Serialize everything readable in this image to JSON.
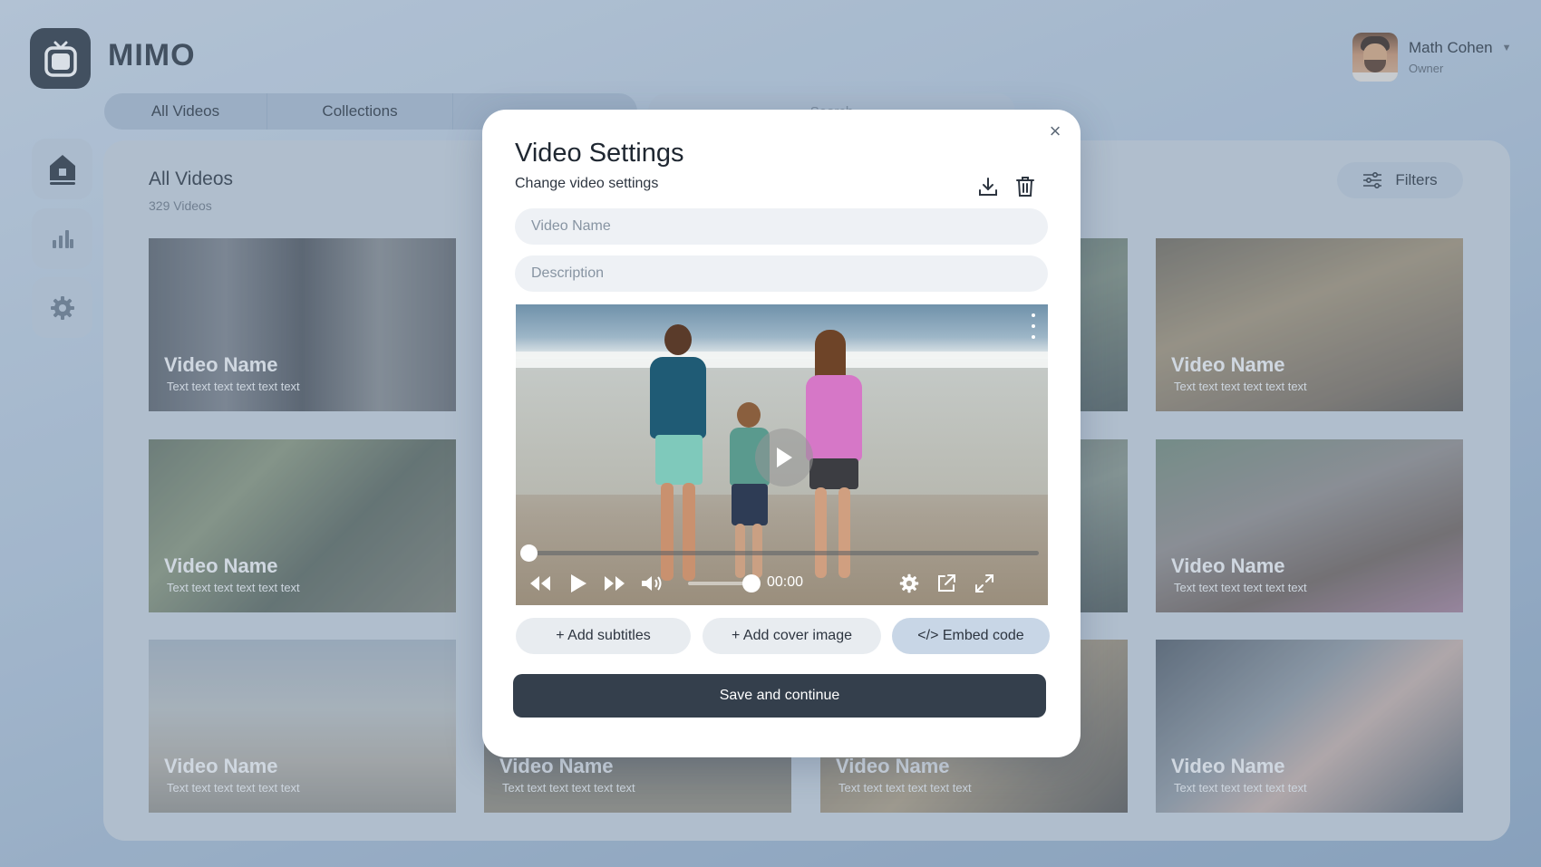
{
  "app": {
    "brand": "MIMO"
  },
  "user": {
    "name": "Math Cohen",
    "role": "Owner"
  },
  "tabs": [
    {
      "label": "All Videos"
    },
    {
      "label": "Collections"
    },
    {
      "label": ""
    }
  ],
  "search": {
    "placeholder": "Search"
  },
  "main": {
    "title": "All Videos",
    "count": "329 Videos",
    "filters_label": "Filters"
  },
  "videos": [
    {
      "name": "Video Name",
      "text": "Text text text text text text"
    },
    {
      "name": "Video Name",
      "text": "Text text text text text text"
    },
    {
      "name": "Video Name",
      "text": "Text text text text text text"
    },
    {
      "name": "Video Name",
      "text": "Text text text text text text"
    },
    {
      "name": "Video Name",
      "text": "Text text text text text text"
    },
    {
      "name": "Video Name",
      "text": "Text text text text text text"
    },
    {
      "name": "Video Name",
      "text": "Text text text text text text"
    },
    {
      "name": "Video Name",
      "text": "Text text text text text text"
    }
  ],
  "modal": {
    "title": "Video Settings",
    "subtitle": "Change video settings",
    "close": "×",
    "fields": {
      "name_placeholder": "Video Name",
      "description_placeholder": "Description"
    },
    "player": {
      "time": "00:00",
      "progress_fraction": 0.0,
      "volume_fraction": 1.0
    },
    "buttons": {
      "subtitles": "+ Add subtitles",
      "cover": "+ Add cover image",
      "embed": "</> Embed code",
      "save": "Save and continue"
    }
  },
  "icons": {
    "logo": "tv-icon",
    "home": "home-icon",
    "stats": "bar-chart-icon",
    "settings": "gear-icon",
    "download": "download-icon",
    "delete": "trash-icon",
    "filters": "sliders-icon"
  },
  "colors": {
    "primary_dark": "#343f4c",
    "accent_light": "#c8d6e6",
    "field_bg": "#eef1f5"
  }
}
